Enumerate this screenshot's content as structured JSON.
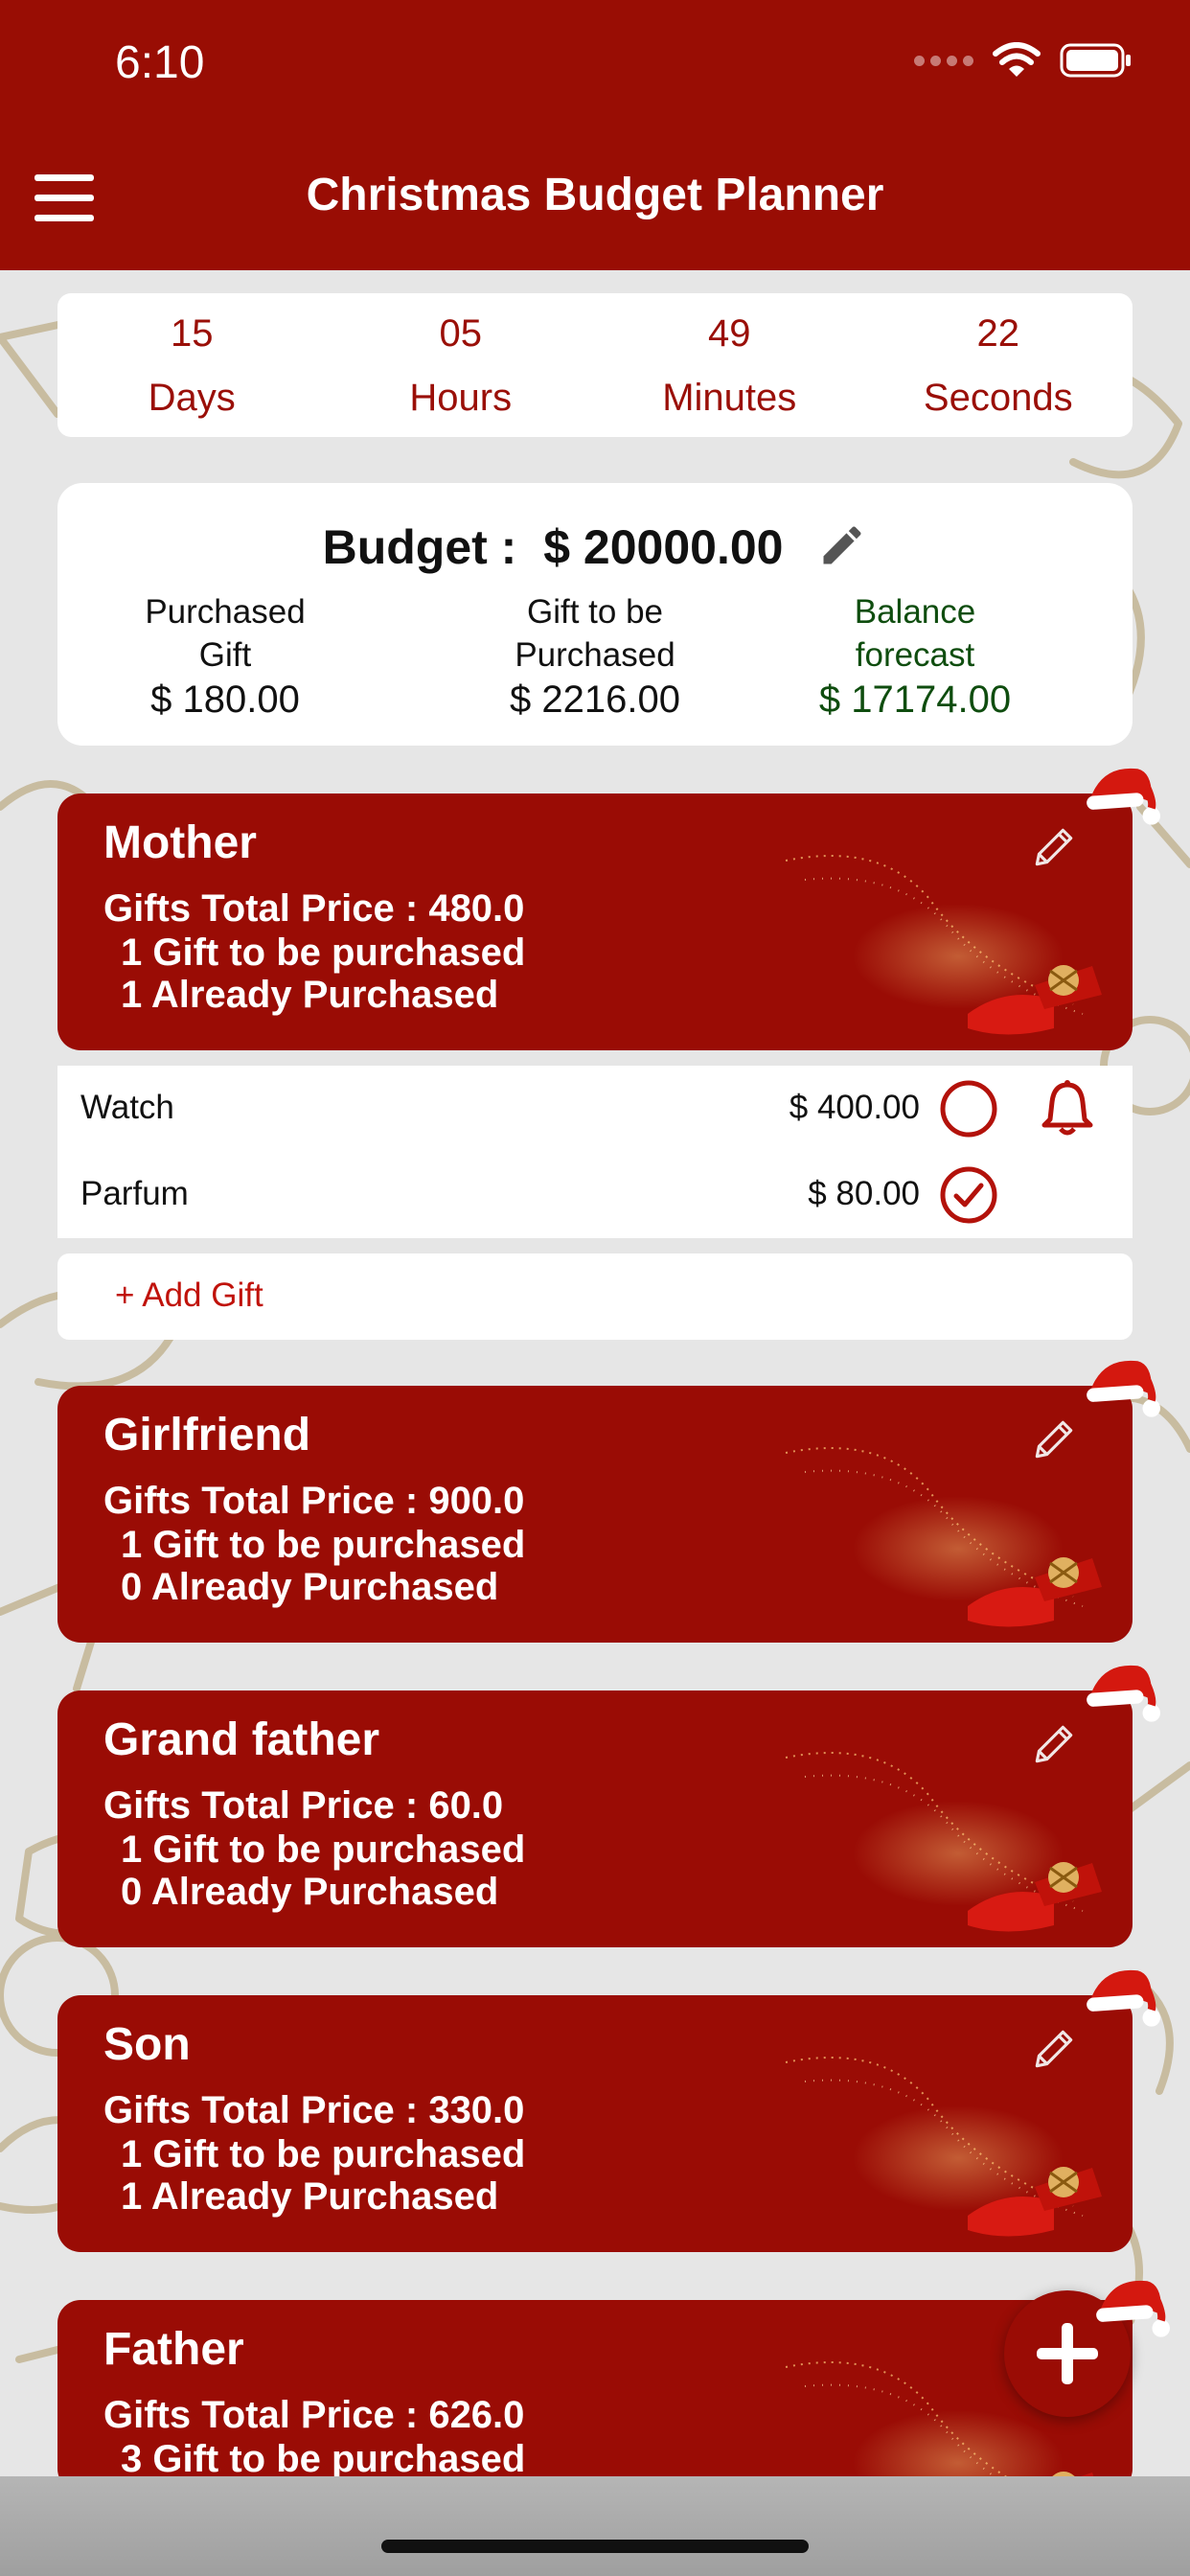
{
  "status_bar": {
    "time": "6:10"
  },
  "header": {
    "title": "Christmas Budget Planner"
  },
  "countdown": [
    {
      "value": "15",
      "label": "Days"
    },
    {
      "value": "05",
      "label": "Hours"
    },
    {
      "value": "49",
      "label": "Minutes"
    },
    {
      "value": "22",
      "label": "Seconds"
    }
  ],
  "budget": {
    "label": "Budget :",
    "amount": "$ 20000.00",
    "purchased_label_1": "Purchased",
    "purchased_label_2": "Gift",
    "purchased_value": "$ 180.00",
    "to_buy_label_1": "Gift to be",
    "to_buy_label_2": "Purchased",
    "to_buy_value": "$ 2216.00",
    "balance_label_1": "Balance",
    "balance_label_2": "forecast",
    "balance_value": "$ 17174.00",
    "balance_color": "#0f4d0f"
  },
  "people": [
    {
      "name": "Mother",
      "total": "Gifts Total Price :  480.0",
      "to_buy": "1  Gift to be purchased",
      "purchased": "1  Already Purchased"
    },
    {
      "name": "Girlfriend",
      "total": "Gifts Total Price :  900.0",
      "to_buy": "1  Gift to be purchased",
      "purchased": "0  Already Purchased"
    },
    {
      "name": "Grand father",
      "total": "Gifts Total Price :  60.0",
      "to_buy": "1  Gift to be purchased",
      "purchased": "0  Already Purchased"
    },
    {
      "name": "Son",
      "total": "Gifts Total Price :  330.0",
      "to_buy": "1  Gift to be purchased",
      "purchased": "1  Already Purchased"
    },
    {
      "name": "Father",
      "total": "Gifts Total Price :  626.0",
      "to_buy": "3  Gift to be purchased",
      "purchased": ""
    }
  ],
  "gifts": [
    {
      "name": "Watch",
      "price": "$ 400.00",
      "purchased": false,
      "reminder": true
    },
    {
      "name": "Parfum",
      "price": "$ 80.00",
      "purchased": true,
      "reminder": false
    }
  ],
  "add_gift_label": "+ Add Gift",
  "colors": {
    "primary": "#990d04",
    "accent_text": "#c0120a"
  },
  "icons": [
    "menu-icon",
    "edit-icon",
    "pencil-icon",
    "bell-icon",
    "check-circle-icon",
    "empty-circle-icon",
    "plus-icon",
    "santa-hat-icon",
    "wifi-icon",
    "battery-icon"
  ]
}
